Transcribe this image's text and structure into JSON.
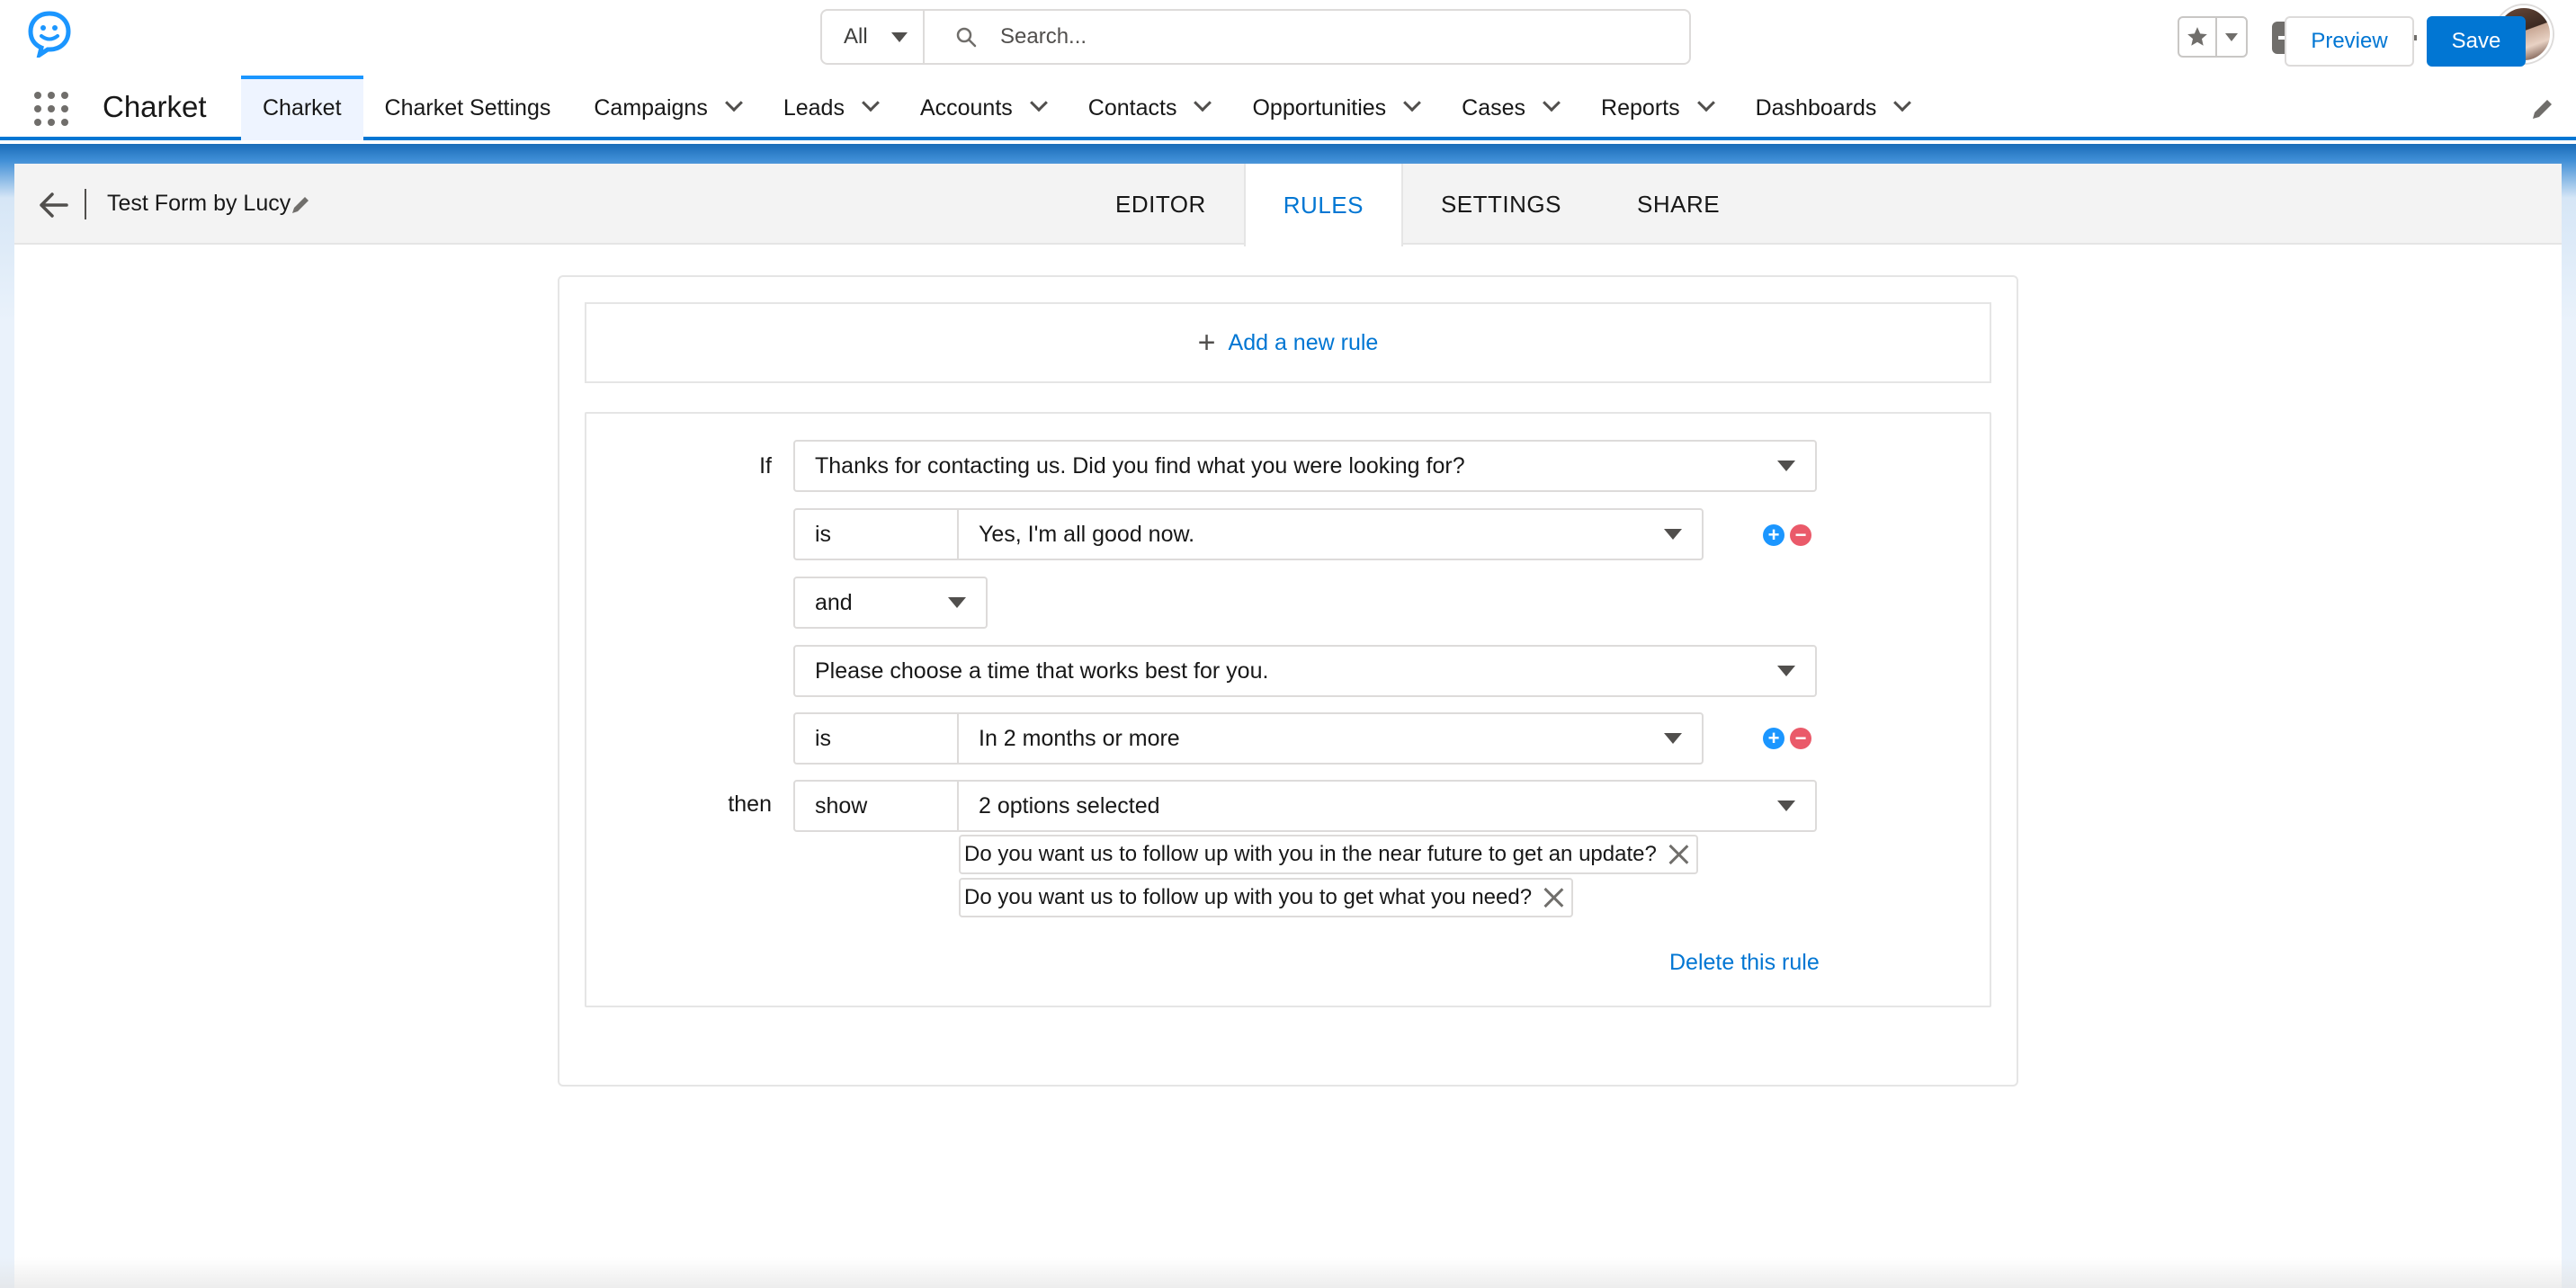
{
  "app": {
    "name": "Charket",
    "brand_color": "#1b96ff",
    "logo_icon": "chat-bubble-smile-icon"
  },
  "search": {
    "scope": "All",
    "placeholder": "Search..."
  },
  "header_icons": [
    "favorites-star-icon",
    "add-icon",
    "trailhead-guide-icon",
    "setup-gear-icon",
    "notifications-bell-icon",
    "user-avatar"
  ],
  "nav": {
    "items": [
      {
        "label": "Charket",
        "active": true,
        "has_menu": false
      },
      {
        "label": "Charket Settings",
        "active": false,
        "has_menu": false
      },
      {
        "label": "Campaigns",
        "active": false,
        "has_menu": true
      },
      {
        "label": "Leads",
        "active": false,
        "has_menu": true
      },
      {
        "label": "Accounts",
        "active": false,
        "has_menu": true
      },
      {
        "label": "Contacts",
        "active": false,
        "has_menu": true
      },
      {
        "label": "Opportunities",
        "active": false,
        "has_menu": true
      },
      {
        "label": "Cases",
        "active": false,
        "has_menu": true
      },
      {
        "label": "Reports",
        "active": false,
        "has_menu": true
      },
      {
        "label": "Dashboards",
        "active": false,
        "has_menu": true
      }
    ]
  },
  "builder": {
    "form_title": "Test Form by Lucy",
    "tabs": [
      {
        "label": "EDITOR",
        "active": false
      },
      {
        "label": "RULES",
        "active": true
      },
      {
        "label": "SETTINGS",
        "active": false
      },
      {
        "label": "SHARE",
        "active": false
      }
    ],
    "preview_label": "Preview",
    "save_label": "Save"
  },
  "rules": {
    "add_rule_label": "Add a new rule",
    "rule": {
      "if_label": "If",
      "condition1": {
        "question": "Thanks for contacting us. Did you find what you were looking for?",
        "operator": "is",
        "value": "Yes, I'm all good now."
      },
      "connector": "and",
      "condition2": {
        "question": "Please choose a time that works best for you.",
        "operator": "is",
        "value": "In 2 months or more"
      },
      "then_label": "then",
      "action": "show",
      "targets_summary": "2 options selected",
      "selected_targets": [
        "Do you want us to follow up with you in the near future to get an update?",
        "Do you want us to follow up with you to get what you need?"
      ],
      "delete_label": "Delete this rule"
    }
  }
}
